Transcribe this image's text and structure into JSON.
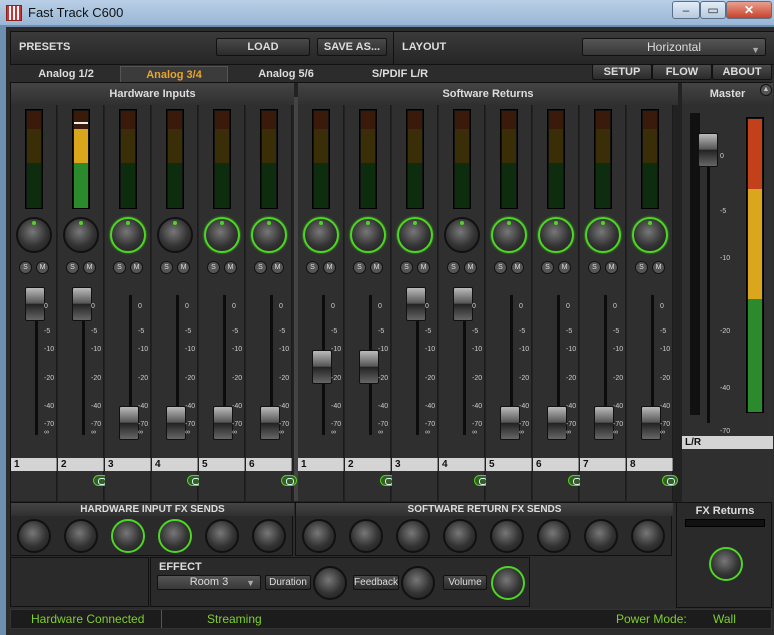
{
  "window": {
    "title": "Fast Track C600",
    "minimize": "–",
    "maximize": "▭",
    "close": "✕"
  },
  "presets": {
    "label": "PRESETS",
    "load": "LOAD",
    "save_as": "SAVE AS..."
  },
  "layout": {
    "label": "LAYOUT",
    "value": "Horizontal"
  },
  "tabs": [
    {
      "label": "Analog 1/2",
      "active": false
    },
    {
      "label": "Analog 3/4",
      "active": true
    },
    {
      "label": "Analog 5/6",
      "active": false
    },
    {
      "label": "S/PDIF L/R",
      "active": false
    }
  ],
  "nav": {
    "setup": "SETUP",
    "flow": "FLOW",
    "about": "ABOUT"
  },
  "groups": {
    "hardware": "Hardware Inputs",
    "software": "Software Returns",
    "master": "Master"
  },
  "scale": [
    "0",
    "-5",
    "-10",
    "-20",
    "-40",
    "-70",
    "∞"
  ],
  "master_scale": [
    "0",
    "-5",
    "-10",
    "-20",
    "-40",
    "-70",
    "∞"
  ],
  "strips": [
    {
      "name": "1",
      "knob_on": false,
      "fader": 0.0,
      "solo": "S",
      "mute": "M"
    },
    {
      "name": "2",
      "knob_on": false,
      "fader": 0.0,
      "solo": "S",
      "mute": "M"
    },
    {
      "name": "3",
      "knob_on": true,
      "fader": 0.85,
      "solo": "S",
      "mute": "M"
    },
    {
      "name": "4",
      "knob_on": false,
      "fader": 0.85,
      "solo": "S",
      "mute": "M"
    },
    {
      "name": "5",
      "knob_on": true,
      "fader": 0.85,
      "solo": "S",
      "mute": "M"
    },
    {
      "name": "6",
      "knob_on": true,
      "fader": 0.85,
      "solo": "S",
      "mute": "M"
    },
    {
      "name": "1",
      "knob_on": true,
      "fader": 0.45,
      "solo": "S",
      "mute": "M"
    },
    {
      "name": "2",
      "knob_on": true,
      "fader": 0.45,
      "solo": "S",
      "mute": "M"
    },
    {
      "name": "3",
      "knob_on": true,
      "fader": 0.0,
      "solo": "S",
      "mute": "M"
    },
    {
      "name": "4",
      "knob_on": false,
      "fader": 0.0,
      "solo": "S",
      "mute": "M"
    },
    {
      "name": "5",
      "knob_on": true,
      "fader": 0.85,
      "solo": "S",
      "mute": "M"
    },
    {
      "name": "6",
      "knob_on": true,
      "fader": 0.85,
      "solo": "S",
      "mute": "M"
    },
    {
      "name": "7",
      "knob_on": true,
      "fader": 0.85,
      "solo": "S",
      "mute": "M"
    },
    {
      "name": "8",
      "knob_on": true,
      "fader": 0.85,
      "solo": "S",
      "mute": "M"
    }
  ],
  "master_strip": {
    "name": "L/R"
  },
  "fx": {
    "hw_sends": "HARDWARE INPUT FX SENDS",
    "sw_sends": "SOFTWARE RETURN FX SENDS",
    "returns": "FX Returns"
  },
  "hw_send_knobs": [
    false,
    false,
    true,
    true,
    false,
    false
  ],
  "sw_send_knobs": [
    false,
    false,
    false,
    false,
    false,
    false,
    false,
    false
  ],
  "effect": {
    "label": "EFFECT",
    "value": "Room 3",
    "duration": "Duration",
    "feedback": "Feedback",
    "volume": "Volume"
  },
  "status": {
    "connection": "Hardware Connected",
    "streaming": "Streaming",
    "power_label": "Power Mode:",
    "power_value": "Wall"
  },
  "colors": {
    "accent": "#e8a52a",
    "led_green": "#4ed624",
    "status_text": "#7fcf2f"
  }
}
